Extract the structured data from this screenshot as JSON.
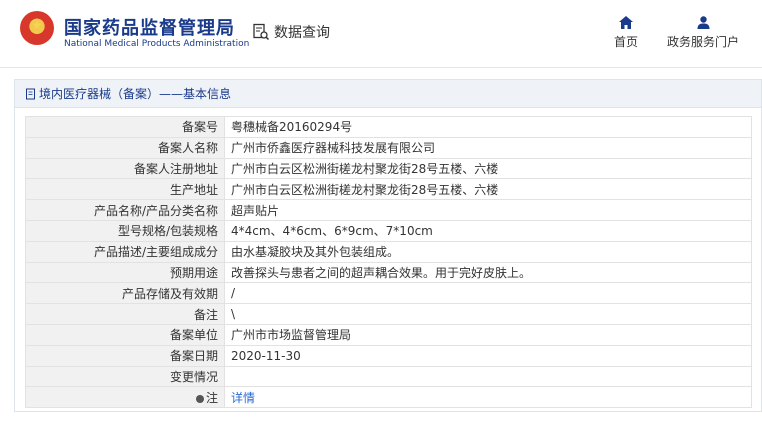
{
  "header": {
    "org_cn": "国家药品监督管理局",
    "org_en": "National Medical Products Administration",
    "search_label": "数据查询",
    "nav": {
      "home": "首页",
      "gov_portal": "政务服务门户"
    }
  },
  "panel": {
    "title": "境内医疗器械（备案）——基本信息",
    "rows": [
      {
        "label": "备案号",
        "value": "粤穗械备20160294号"
      },
      {
        "label": "备案人名称",
        "value": "广州市侨鑫医疗器械科技发展有限公司"
      },
      {
        "label": "备案人注册地址",
        "value": "广州市白云区松洲街槎龙村聚龙街28号五楼、六楼"
      },
      {
        "label": "生产地址",
        "value": "广州市白云区松洲街槎龙村聚龙街28号五楼、六楼"
      },
      {
        "label": "产品名称/产品分类名称",
        "value": "超声贴片"
      },
      {
        "label": "型号规格/包装规格",
        "value": "4*4cm、4*6cm、6*9cm、7*10cm"
      },
      {
        "label": "产品描述/主要组成成分",
        "value": "由水基凝胶块及其外包装组成。"
      },
      {
        "label": "预期用途",
        "value": "改善探头与患者之间的超声耦合效果。用于完好皮肤上。"
      },
      {
        "label": "产品存储及有效期",
        "value": "/"
      },
      {
        "label": "备注",
        "value": "\\"
      },
      {
        "label": "备案单位",
        "value": "广州市市场监督管理局"
      },
      {
        "label": "备案日期",
        "value": "2020-11-30"
      },
      {
        "label": "变更情况",
        "value": ""
      },
      {
        "label": "注",
        "value": "详情"
      }
    ]
  },
  "colors": {
    "brand_blue": "#1a3a8a",
    "link_blue": "#2a6bd6",
    "label_bg": "#f1f1f1",
    "title_bg": "#eff3f8"
  }
}
